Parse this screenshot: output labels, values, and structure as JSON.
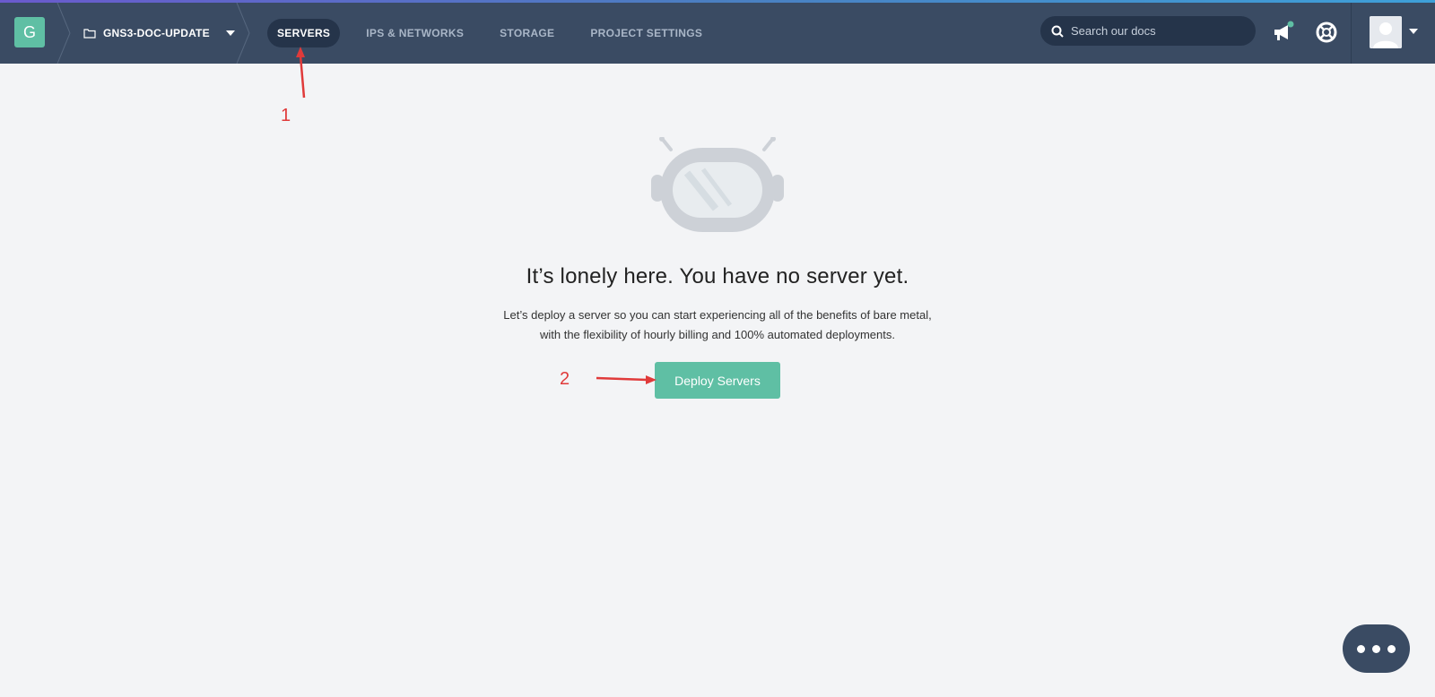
{
  "header": {
    "org_initial": "G",
    "project_name": "GNS3-DOC-UPDATE",
    "nav": [
      {
        "label": "SERVERS",
        "active": true
      },
      {
        "label": "IPS & NETWORKS",
        "active": false
      },
      {
        "label": "STORAGE",
        "active": false
      },
      {
        "label": "PROJECT SETTINGS",
        "active": false
      }
    ],
    "search_placeholder": "Search our docs"
  },
  "empty_state": {
    "headline": "It’s lonely here. You have no server yet.",
    "description_line1": "Let’s deploy a server so you can start experiencing all of the benefits of bare metal,",
    "description_line2": "with the flexibility of hourly billing and 100% automated deployments.",
    "deploy_button": "Deploy Servers"
  },
  "annotations": [
    {
      "label": "1"
    },
    {
      "label": "2"
    }
  ],
  "colors": {
    "topbar": "#3a4b63",
    "accent": "#5fbfa4",
    "annotation": "#e03a3a"
  },
  "icons": [
    "folder-icon",
    "caret-down-icon",
    "search-icon",
    "megaphone-icon",
    "lifebuoy-icon",
    "user-avatar-icon",
    "chat-dots-icon"
  ]
}
